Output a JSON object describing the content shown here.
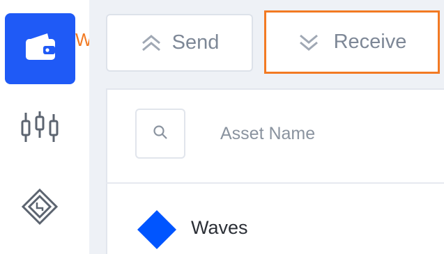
{
  "sidebar": {
    "items": [
      {
        "id": "wallet",
        "icon": "wallet-icon",
        "active": true
      },
      {
        "id": "trade",
        "icon": "candlestick-chart-icon",
        "active": false
      },
      {
        "id": "dex",
        "icon": "dex-diamond-icon",
        "active": false
      }
    ],
    "annotation_label": "Wallet"
  },
  "actions": {
    "send_label": "Send",
    "receive_label": "Receive"
  },
  "assets_table": {
    "search_icon": "search-icon",
    "column_header": "Asset Name",
    "rows": [
      {
        "name": "Waves",
        "icon": "waves-diamond-icon"
      }
    ]
  },
  "colors": {
    "accent": "#1f5af6",
    "highlight": "#f27a23",
    "waves_blue": "#0055ff"
  }
}
